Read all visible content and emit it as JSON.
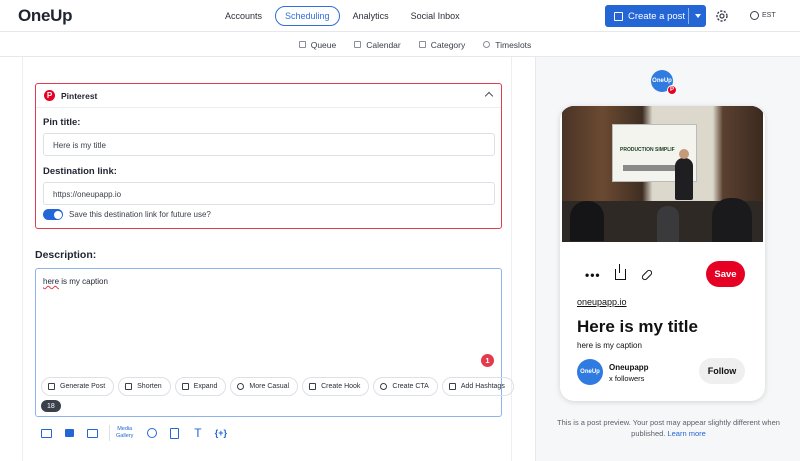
{
  "app": {
    "logo": "OneUp"
  },
  "nav": {
    "items": [
      "Accounts",
      "Scheduling",
      "Analytics",
      "Social Inbox"
    ],
    "active": "Scheduling",
    "create_label": "Create a post",
    "timezone": "EST"
  },
  "subnav": {
    "items": [
      "Queue",
      "Calendar",
      "Category",
      "Timeslots"
    ]
  },
  "pinterest": {
    "header": "Pinterest",
    "pin_title_label": "Pin title:",
    "pin_title_value": "Here is my title",
    "dest_label": "Destination link:",
    "dest_value": "https://oneupapp.io",
    "save_link_label": "Save this destination link for future use?",
    "save_link_on": true
  },
  "description": {
    "label": "Description:",
    "text_misspelled": "here",
    "text_rest": " is my caption",
    "error_count": "1",
    "char_count": "18",
    "ai_actions": [
      "Generate Post",
      "Shorten",
      "Expand",
      "More Casual",
      "Create Hook",
      "Create CTA",
      "Add Hashtags"
    ]
  },
  "toolbar": {
    "media_gallery_line1": "Media",
    "media_gallery_line2": "Gallery",
    "variables_label": "{+}",
    "text_tool": "T",
    "icons": [
      "image-icon",
      "video-icon",
      "gif-icon",
      "emoji-icon",
      "clipboard-icon",
      "text-icon",
      "variables-icon"
    ]
  },
  "preview": {
    "account_avatar_text": "OneUp",
    "photo_screen_text": "PRODUCTION SIMPLIF",
    "save_label": "Save",
    "domain": "oneupapp.io",
    "title": "Here is my title",
    "caption": "here is my caption",
    "account_name": "Oneupapp",
    "followers": "x followers",
    "follow_label": "Follow",
    "note": "This is a post preview. Your post may appear slightly different when published.",
    "learn_more": "Learn more"
  },
  "colors": {
    "accent": "#2466d6",
    "pinterest_red": "#e60023",
    "error_red": "#e23b4e"
  }
}
